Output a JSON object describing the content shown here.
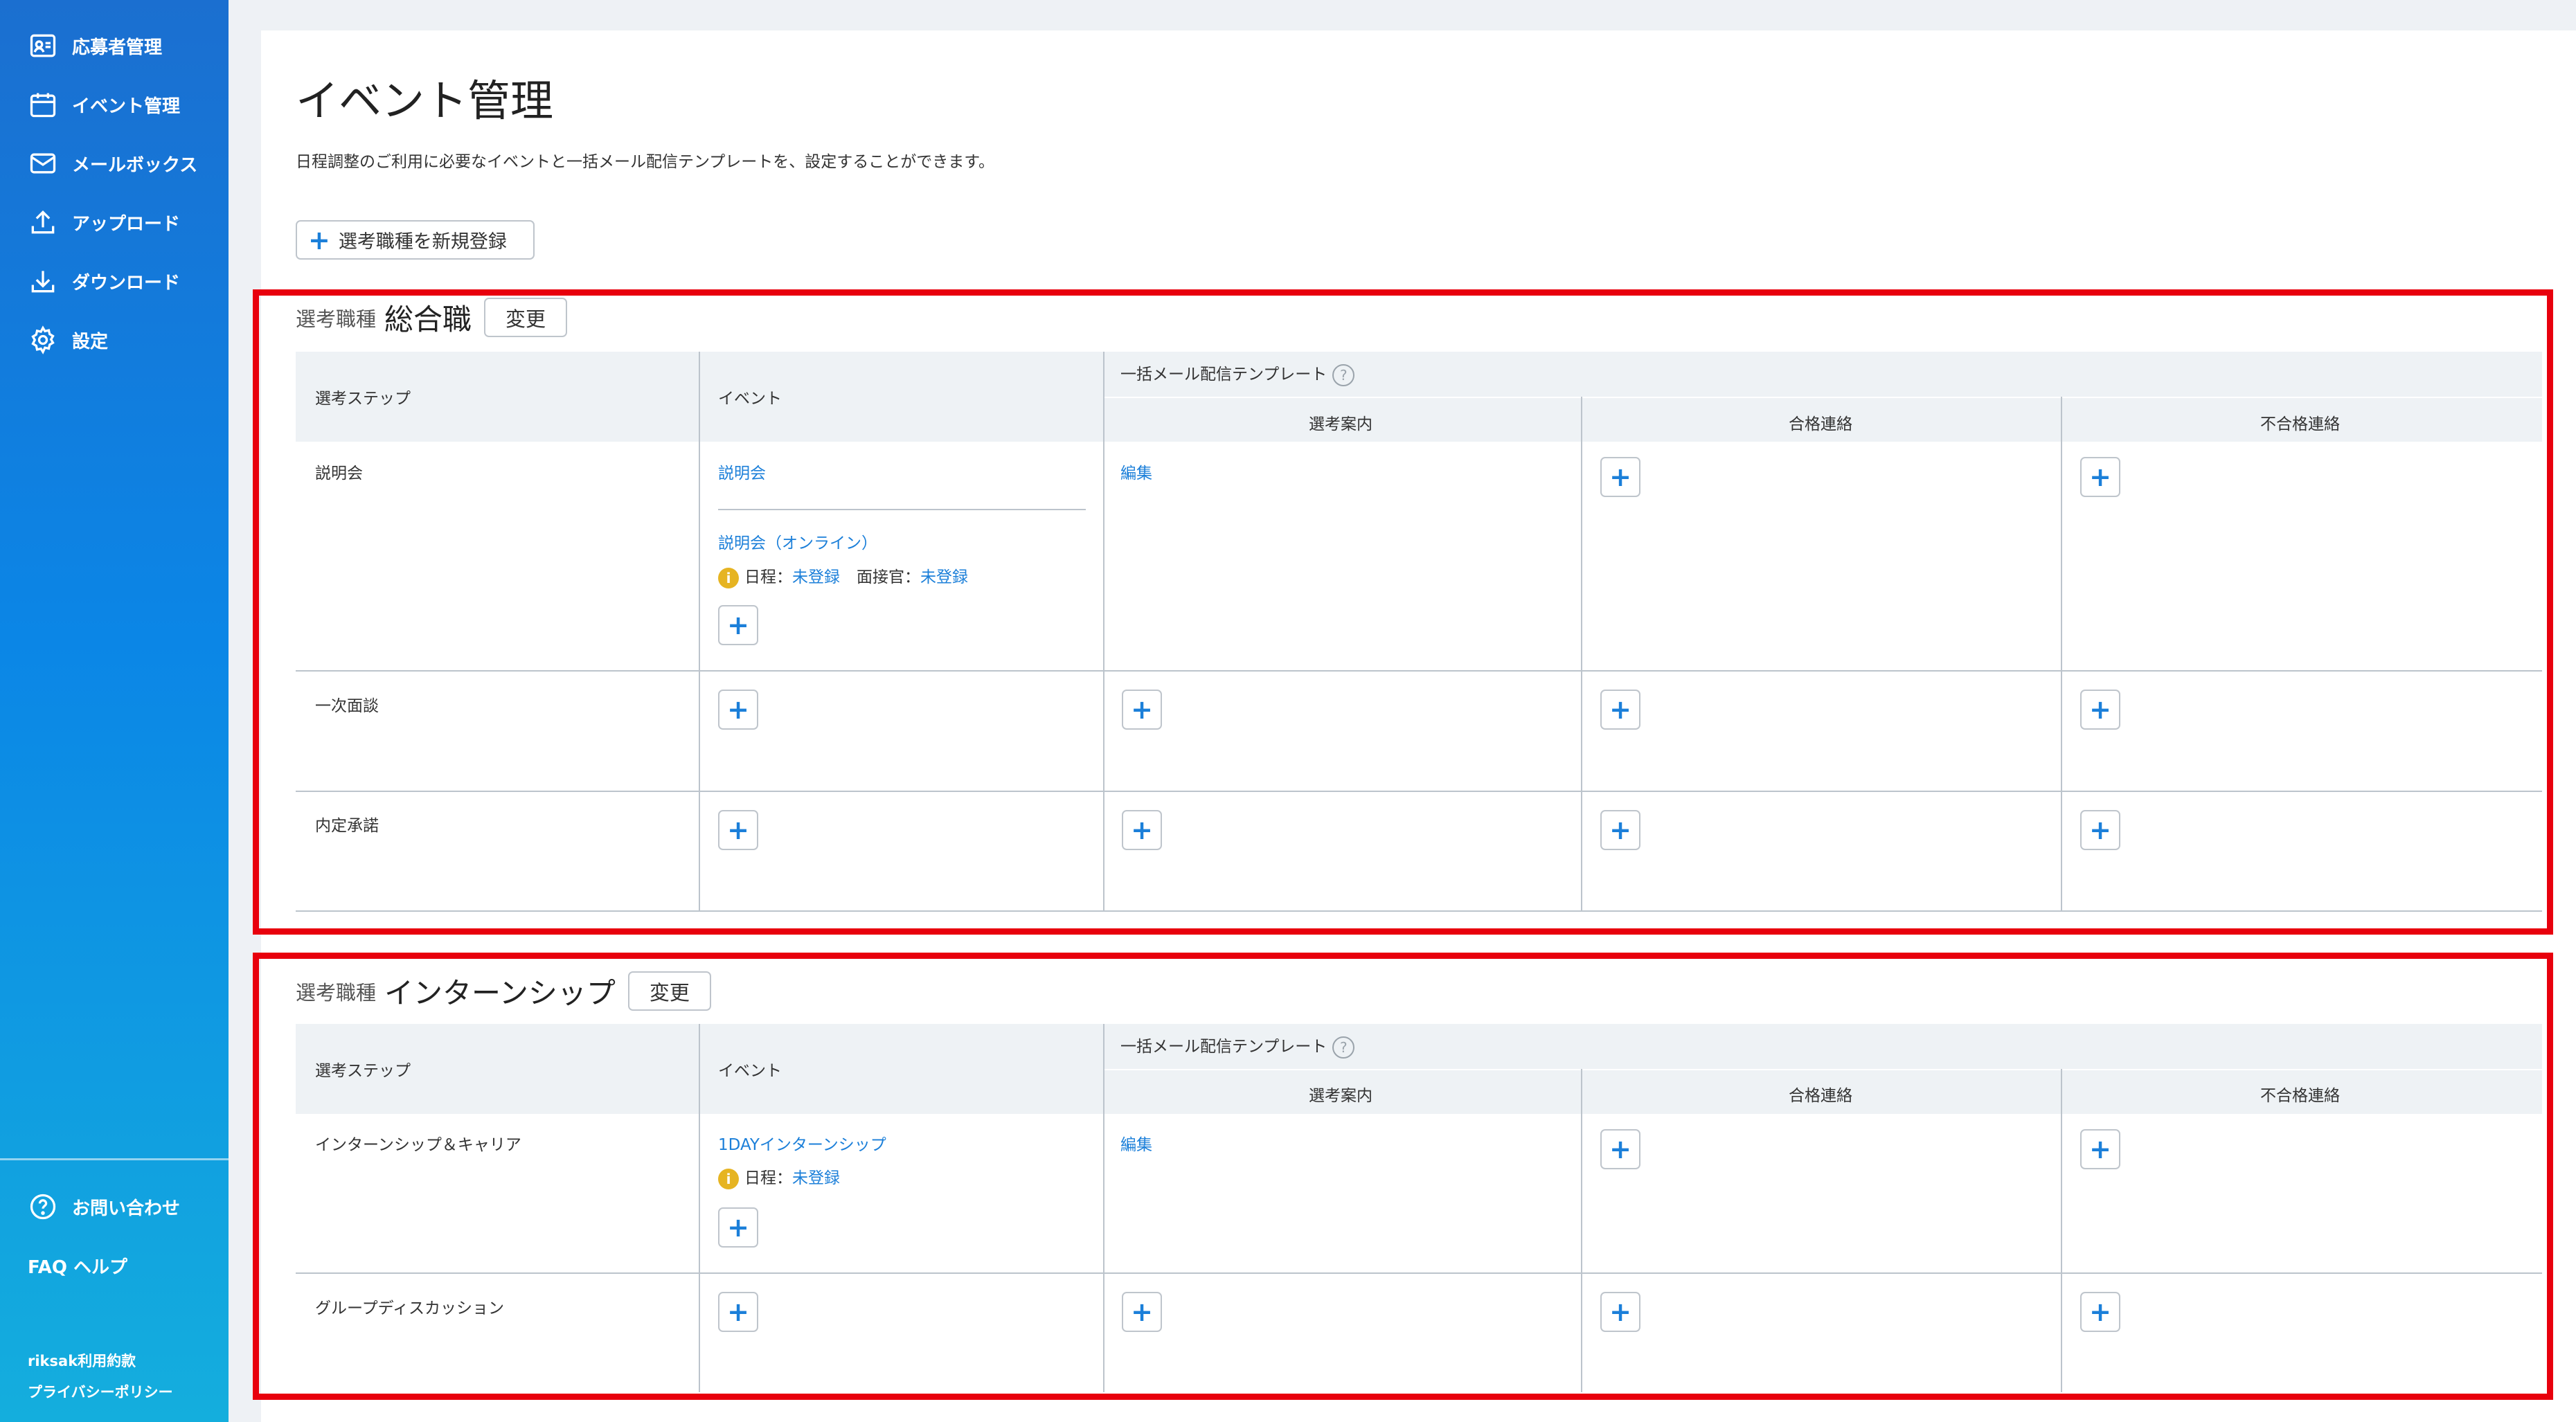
{
  "sidebar": {
    "items": [
      {
        "label": "応募者管理",
        "icon": "applicant-card-icon"
      },
      {
        "label": "イベント管理",
        "icon": "calendar-icon"
      },
      {
        "label": "メールボックス",
        "icon": "mail-icon"
      },
      {
        "label": "アップロード",
        "icon": "upload-icon"
      },
      {
        "label": "ダウンロード",
        "icon": "download-icon"
      },
      {
        "label": "設定",
        "icon": "gear-icon"
      }
    ],
    "contact": "お問い合わせ",
    "faq": "FAQ ヘルプ",
    "terms": "riksak利用約款",
    "privacy": "プライバシーポリシー"
  },
  "page": {
    "title": "イベント管理",
    "subtitle": "日程調整のご利用に必要なイベントと一括メール配信テンプレートを、設定することができます。",
    "add_button": "選考職種を新規登録"
  },
  "table_headers": {
    "step": "選考ステップ",
    "event": "イベント",
    "template": "一括メール配信テンプレート",
    "guide": "選考案内",
    "pass": "合格連絡",
    "fail": "不合格連絡"
  },
  "common": {
    "section_label": "選考職種",
    "change": "変更",
    "edit": "編集",
    "schedule_label": "日程：",
    "interviewer_label": "面接官：",
    "unregistered": "未登録"
  },
  "sections": [
    {
      "name": "総合職",
      "rows": [
        {
          "step": "説明会",
          "events": [
            "説明会",
            "説明会（オンライン）"
          ]
        },
        {
          "step": "一次面談"
        },
        {
          "step": "内定承諾"
        }
      ]
    },
    {
      "name": "インターンシップ",
      "rows": [
        {
          "step": "インターンシップ＆キャリア",
          "events": [
            "1DAYインターンシップ"
          ]
        },
        {
          "step": "グループディスカッション"
        }
      ]
    }
  ],
  "colors": {
    "accent": "#1b7fd9",
    "highlight_frame": "#e8000d",
    "warning": "#e6b422",
    "sidebar_top": "#1b6fd0",
    "sidebar_bottom": "#14aedd"
  }
}
